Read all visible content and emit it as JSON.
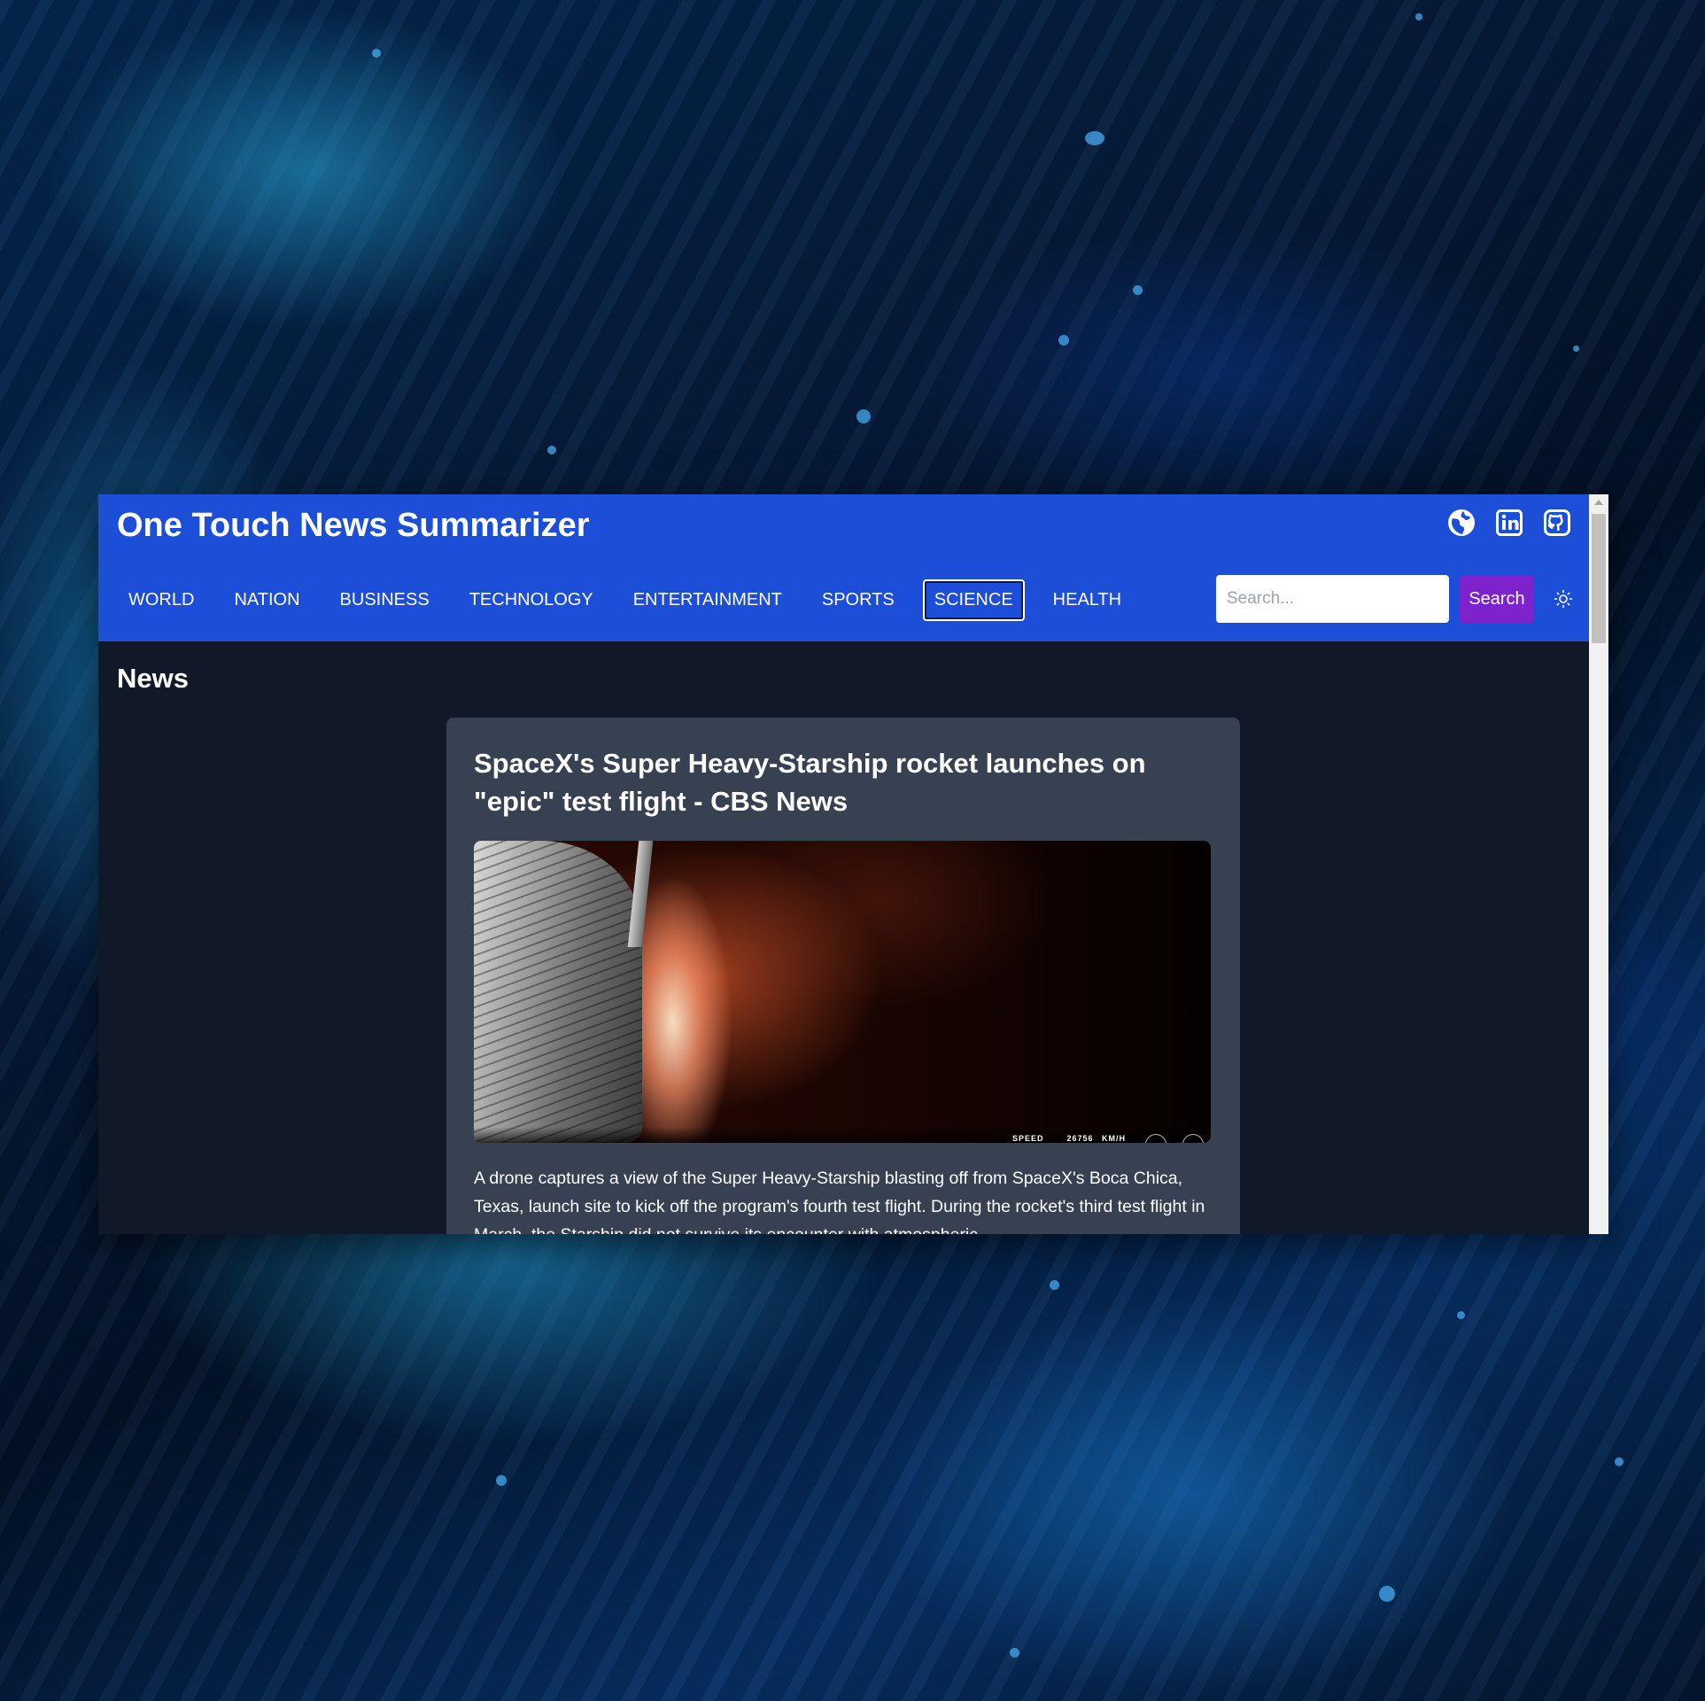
{
  "app": {
    "title": "One Touch News Summarizer"
  },
  "header": {
    "social_icons": [
      {
        "name": "globe-icon"
      },
      {
        "name": "linkedin-icon"
      },
      {
        "name": "github-icon"
      }
    ]
  },
  "nav": {
    "items": [
      {
        "label": "WORLD",
        "active": false
      },
      {
        "label": "NATION",
        "active": false
      },
      {
        "label": "BUSINESS",
        "active": false
      },
      {
        "label": "TECHNOLOGY",
        "active": false
      },
      {
        "label": "ENTERTAINMENT",
        "active": false
      },
      {
        "label": "SPORTS",
        "active": false
      },
      {
        "label": "SCIENCE",
        "active": true
      },
      {
        "label": "HEALTH",
        "active": false
      }
    ]
  },
  "search": {
    "placeholder": "Search...",
    "value": "",
    "button_label": "Search"
  },
  "theme_toggle": {
    "icon": "sun-icon"
  },
  "main": {
    "section_title": "News",
    "articles": [
      {
        "title": "SpaceX's Super Heavy-Starship rocket launches on \"epic\" test flight - CBS News",
        "image_telemetry": {
          "label": "SPEED",
          "value": "26756",
          "unit": "KM/H"
        },
        "description": "A drone captures a view of the Super Heavy-Starship blasting off from SpaceX's Boca Chica, Texas, launch site to kick off the program's fourth test flight. During the rocket's third test flight in March, the Starship did not survive its encounter with atmospheric"
      }
    ]
  },
  "colors": {
    "header_bg": "#1d4ed8",
    "page_bg": "#111827",
    "card_bg": "#374151",
    "search_button_bg": "#7e22ce"
  }
}
